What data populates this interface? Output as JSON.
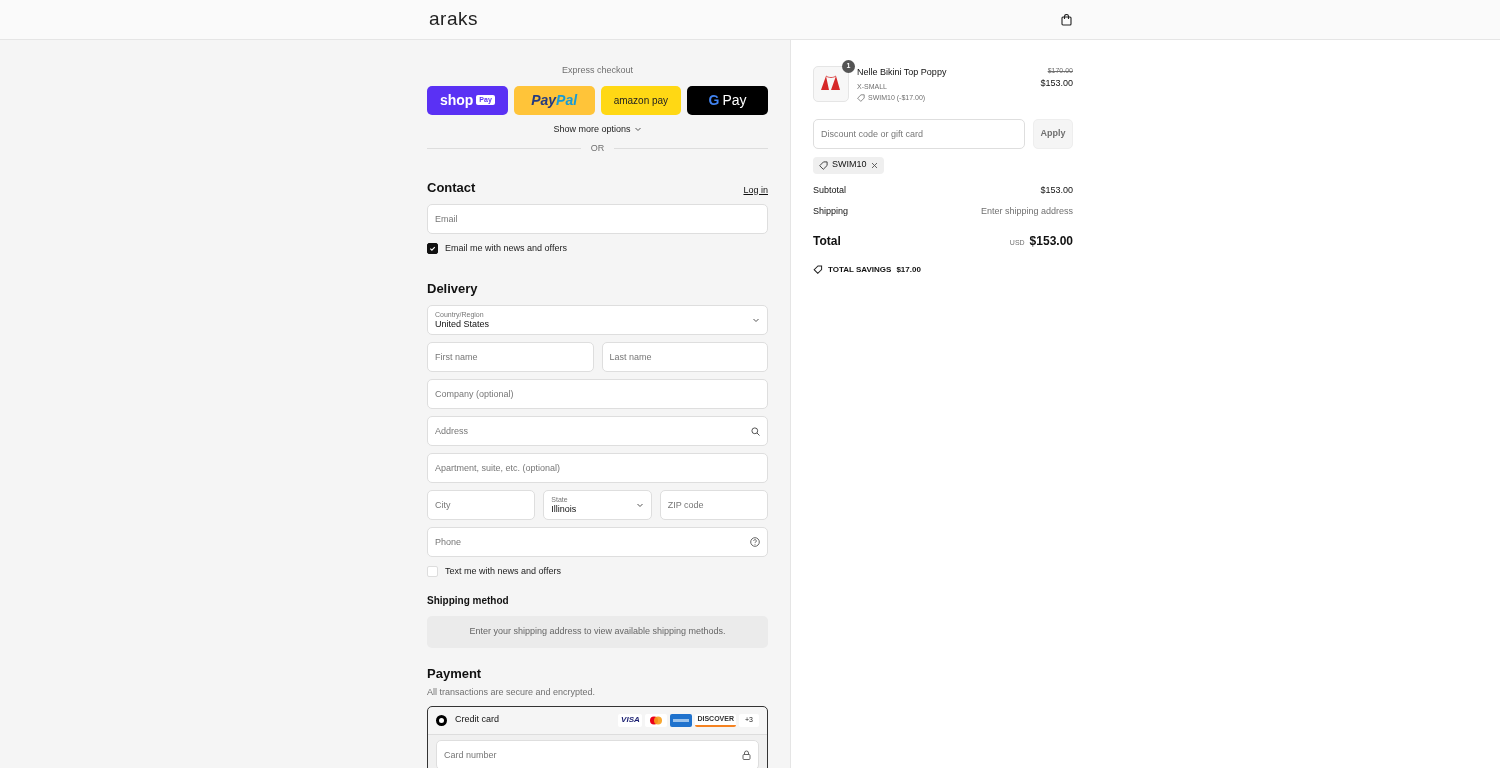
{
  "header": {
    "logo": "araks"
  },
  "express": {
    "title": "Express checkout",
    "buttons": [
      {
        "kind": "shop",
        "label": "shop",
        "badge": "Pay"
      },
      {
        "kind": "paypal",
        "label": "Pay",
        "label2": "Pal"
      },
      {
        "kind": "amazon",
        "label": "amazon pay"
      },
      {
        "kind": "gpay",
        "label": "G",
        "label2": "Pay"
      }
    ],
    "more": "Show more options",
    "divider": "OR"
  },
  "contact": {
    "title": "Contact",
    "login": "Log in",
    "email": {
      "placeholder": "Email"
    },
    "newsletter": {
      "label": "Email me with news and offers",
      "checked": true
    }
  },
  "delivery": {
    "title": "Delivery",
    "country": {
      "label": "Country/Region",
      "value": "United States"
    },
    "first_name": {
      "placeholder": "First name"
    },
    "last_name": {
      "placeholder": "Last name"
    },
    "company": {
      "placeholder": "Company (optional)"
    },
    "address": {
      "placeholder": "Address"
    },
    "apartment": {
      "placeholder": "Apartment, suite, etc. (optional)"
    },
    "city": {
      "placeholder": "City"
    },
    "state": {
      "label": "State",
      "value": "Illinois"
    },
    "zip": {
      "placeholder": "ZIP code"
    },
    "phone": {
      "placeholder": "Phone"
    },
    "sms": {
      "label": "Text me with news and offers",
      "checked": false
    }
  },
  "shipping_method": {
    "title": "Shipping method",
    "message": "Enter your shipping address to view available shipping methods."
  },
  "payment": {
    "title": "Payment",
    "subtitle": "All transactions are secure and encrypted.",
    "methods": [
      {
        "label": "Credit card",
        "selected": true,
        "brands": [
          {
            "kind": "visa",
            "label": "VISA"
          },
          {
            "kind": "mastercard"
          },
          {
            "kind": "amex"
          },
          {
            "kind": "discover",
            "label": "DISCOVER"
          },
          {
            "kind": "more",
            "label": "+3"
          }
        ]
      }
    ],
    "card_number": {
      "placeholder": "Card number"
    }
  },
  "summary": {
    "items": [
      {
        "name": "Nelle Bikini Top Poppy",
        "quantity": "1",
        "variant": "X-SMALL",
        "discount": "SWIM10 (-$17.00)",
        "original_price": "$170.00",
        "price": "$153.00"
      }
    ],
    "discount_field": {
      "placeholder": "Discount code or gift card"
    },
    "apply": "Apply",
    "codes": [
      "SWIM10"
    ],
    "subtotal": {
      "label": "Subtotal",
      "value": "$153.00"
    },
    "shipping": {
      "label": "Shipping",
      "value": "Enter shipping address"
    },
    "total": {
      "label": "Total",
      "currency": "USD",
      "value": "$153.00"
    },
    "savings": {
      "label": "TOTAL SAVINGS",
      "value": "$17.00"
    }
  }
}
